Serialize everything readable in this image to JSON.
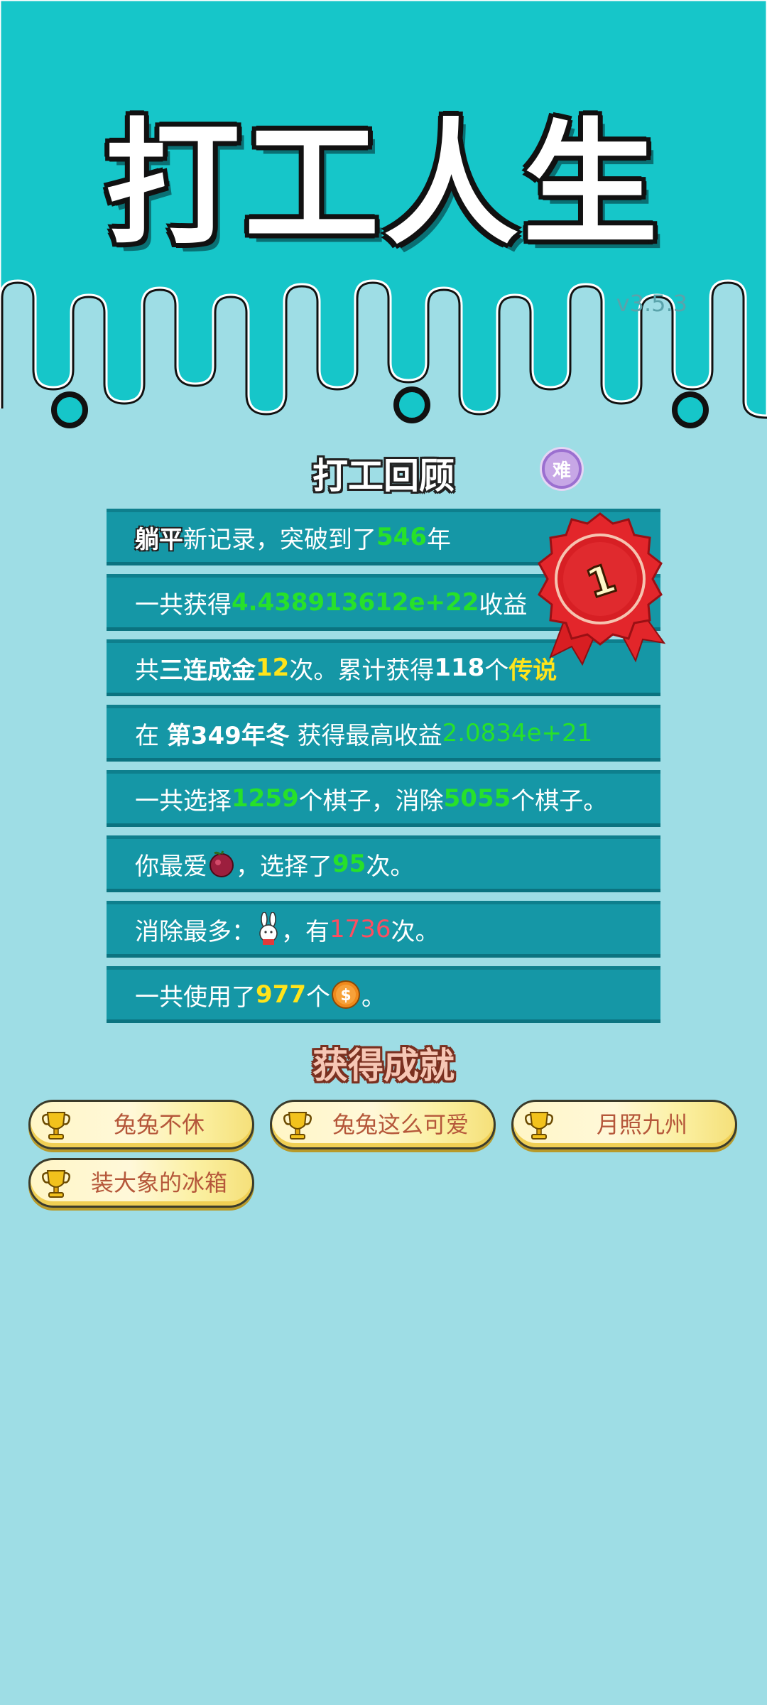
{
  "app": {
    "title": "打工人生",
    "version": "v3.5.3"
  },
  "review": {
    "title": "打工回顾",
    "difficulty_badge": "难",
    "rank_medal": "1",
    "rows": {
      "r1": {
        "a": "躺平",
        "b": "新记录，突破到了",
        "c": "546",
        "d": "年"
      },
      "r2": {
        "a": "一共获得",
        "b": "4.438913612e+22",
        "c": "收益"
      },
      "r3": {
        "a": "共",
        "b": "三连成金",
        "c": "12",
        "d": "次。累计获得",
        "e": "118",
        "f": "个",
        "g": "传说"
      },
      "r4": {
        "a": "在 ",
        "b": "第349年冬",
        "c": " 获得最高收益",
        "d": "2.0834e+21"
      },
      "r5": {
        "a": "一共选择",
        "b": "1259",
        "c": "个棋子，消除",
        "d": "5055",
        "e": "个棋子。"
      },
      "r6": {
        "a": "你最爱",
        "b": "，选择了",
        "c": "95",
        "d": "次。",
        "icon": "red-fruit-icon"
      },
      "r7": {
        "a": "消除最多：",
        "b": "，有",
        "c": "1736",
        "d": "次。",
        "icon": "rabbit-icon"
      },
      "r8": {
        "a": "一共使用了",
        "b": "977",
        "c": "个",
        "d": "。",
        "icon": "coin-icon"
      }
    }
  },
  "achievements": {
    "title": "获得成就",
    "items": [
      "兔兔不休",
      "兔兔这么可爱",
      "月照九州",
      "装大象的冰箱"
    ]
  },
  "colors": {
    "top_bg": "#16c6c9",
    "page_bg": "#9edde5",
    "row_bg": "#1597a6",
    "green": "#27e12a",
    "yellow": "#ffe41a",
    "red": "#ff4d60"
  }
}
